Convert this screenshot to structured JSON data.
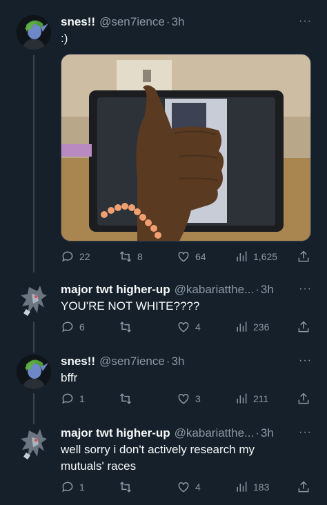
{
  "tweets": [
    {
      "name": "snes!!",
      "handle": "@sen7ience",
      "time": "3h",
      "text": ":)",
      "more": "···",
      "replies": "22",
      "retweets": "8",
      "likes": "64",
      "views": "1,625"
    },
    {
      "name": "major twt higher-up",
      "handle": "@kabariatthe...",
      "time": "3h",
      "text": "YOU'RE NOT WHITE????",
      "more": "···",
      "replies": "6",
      "retweets": "",
      "likes": "4",
      "views": "236"
    },
    {
      "name": "snes!!",
      "handle": "@sen7ience",
      "time": "3h",
      "text": "bffr",
      "more": "···",
      "replies": "1",
      "retweets": "",
      "likes": "3",
      "views": "211"
    },
    {
      "name": "major twt higher-up",
      "handle": "@kabariatthe...",
      "time": "3h",
      "text": "well sorry i don't actively research my mutuals' races",
      "more": "···",
      "replies": "1",
      "retweets": "",
      "likes": "4",
      "views": "183"
    }
  ],
  "colors": {
    "background": "#15202b",
    "text": "#f7f9f9",
    "secondary": "#8b98a5",
    "divider": "#38444d"
  },
  "icons": [
    "reply-icon",
    "retweet-icon",
    "like-icon",
    "views-icon",
    "share-icon",
    "more-icon"
  ]
}
